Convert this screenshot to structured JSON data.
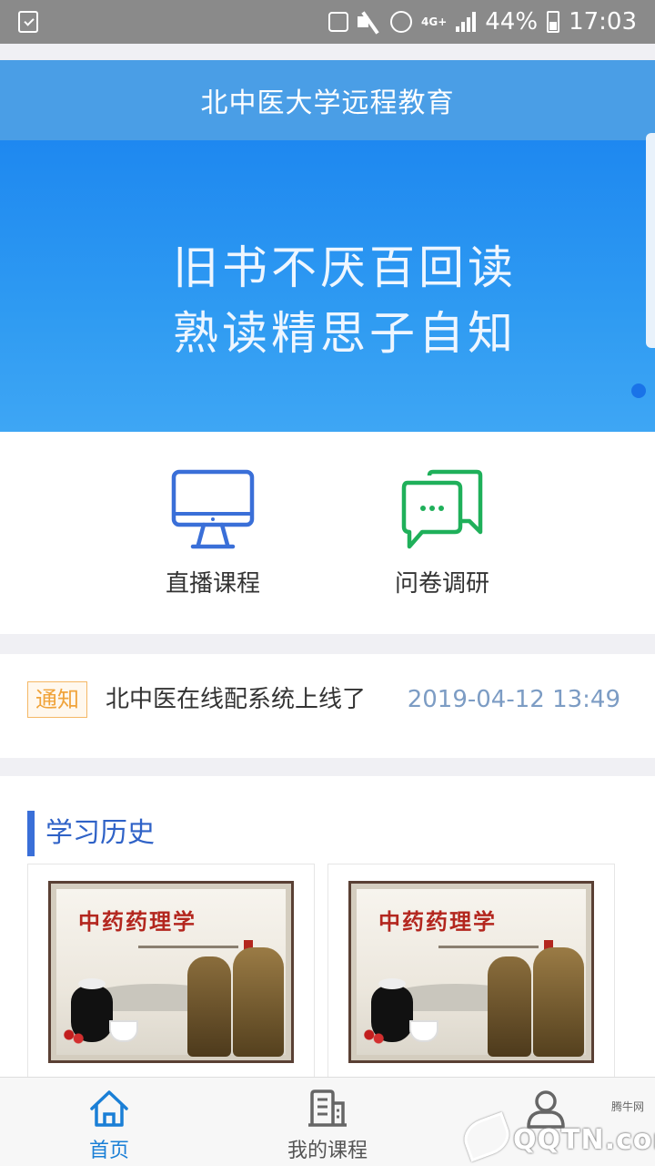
{
  "status_bar": {
    "battery": "44%",
    "network": "4G+",
    "time": "17:03"
  },
  "header": {
    "title": "北中医大学远程教育"
  },
  "banner": {
    "line1": "旧书不厌百回读",
    "line2": "熟读精思子自知",
    "slide_count": 1,
    "active_slide": 1
  },
  "actions": [
    {
      "label": "直播课程",
      "icon": "monitor-icon"
    },
    {
      "label": "问卷调研",
      "icon": "chat-bubbles-icon"
    }
  ],
  "notice": {
    "tag": "通知",
    "text": "北中医在线配系统上线了",
    "time": "2019-04-12 13:49"
  },
  "history": {
    "title": "学习历史",
    "cards": [
      {
        "thumb_title": "中药药理学"
      },
      {
        "thumb_title": "中药药理学"
      }
    ]
  },
  "bottom_nav": {
    "items": [
      {
        "label": "首页",
        "icon": "home-icon",
        "active": true
      },
      {
        "label": "我的课程",
        "icon": "building-icon",
        "active": false
      },
      {
        "label": "",
        "icon": "user-icon",
        "active": false
      }
    ]
  },
  "watermark": {
    "text": "QQTN.com",
    "small": "腾牛网"
  },
  "colors": {
    "header": "#4a9ee6",
    "banner": "#1e88f0",
    "accent": "#1a7fd6",
    "notice_tag": "#f0a33a",
    "notice_time": "#7c9cc4",
    "section_bar": "#3a6fd8",
    "survey_icon": "#1fb05a",
    "live_icon": "#3a6fd8"
  }
}
